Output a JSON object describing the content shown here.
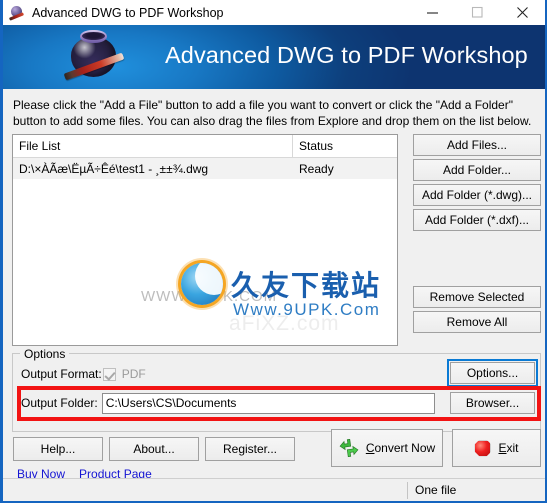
{
  "window": {
    "title": "Advanced DWG to PDF Workshop",
    "title_icon": "inkbottle-pen-icon",
    "controls": {
      "minimize": "minimize-icon",
      "maximize": "maximize-icon",
      "close": "close-icon"
    },
    "border_color": "#1565c0"
  },
  "banner": {
    "title": "Advanced DWG to PDF Workshop",
    "logo_icon": "inkbottle-pen-logo",
    "gradient_light": "#2090dd",
    "gradient_dark": "#0d3470"
  },
  "instructions": "Please click the \"Add a File\" button to add a file you want to convert or click the \"Add a Folder\" button to add some files. You can also drag the files from Explore and drop them on the list below.",
  "file_list": {
    "columns": [
      "File List",
      "Status"
    ],
    "rows": [
      {
        "file": "D:\\×ÀÃæ\\ËµÃ÷Êé\\test1 - ¸±±¾.dwg",
        "status": "Ready"
      }
    ]
  },
  "watermark": {
    "chinese": "久友下载站",
    "english": "Www.9UPK.Com",
    "ghost_url": "WWW.9UPK.COM",
    "ghost_url2": "aFiXZ.com"
  },
  "side_buttons": {
    "add_files": "Add Files...",
    "add_folder": "Add Folder...",
    "add_folder_dwg": "Add Folder (*.dwg)...",
    "add_folder_dxf": "Add Folder (*.dxf)...",
    "remove_selected": "Remove Selected",
    "remove_all": "Remove All"
  },
  "options": {
    "group_label": "Options",
    "output_format_label": "Output Format:",
    "output_format_value": "PDF",
    "output_format_checked": true,
    "options_button": "Options...",
    "output_folder_label": "Output Folder:",
    "output_folder_value": "C:\\Users\\CS\\Documents",
    "browser_button": "Browser...",
    "highlight_color": "#0a7ad4",
    "annotation_color": "#f21313"
  },
  "bottom": {
    "help": "Help...",
    "about": "About...",
    "register": "Register...",
    "convert_accel": "C",
    "convert_rest": "onvert Now",
    "exit_accel": "E",
    "exit_rest": "xit",
    "convert_icon": "green-arrows-icon",
    "exit_icon": "red-stop-octagon-icon"
  },
  "links": {
    "buy_now": "Buy Now",
    "product_page": "Product Page",
    "color": "#1414d2"
  },
  "statusbar": {
    "text": "One file"
  }
}
